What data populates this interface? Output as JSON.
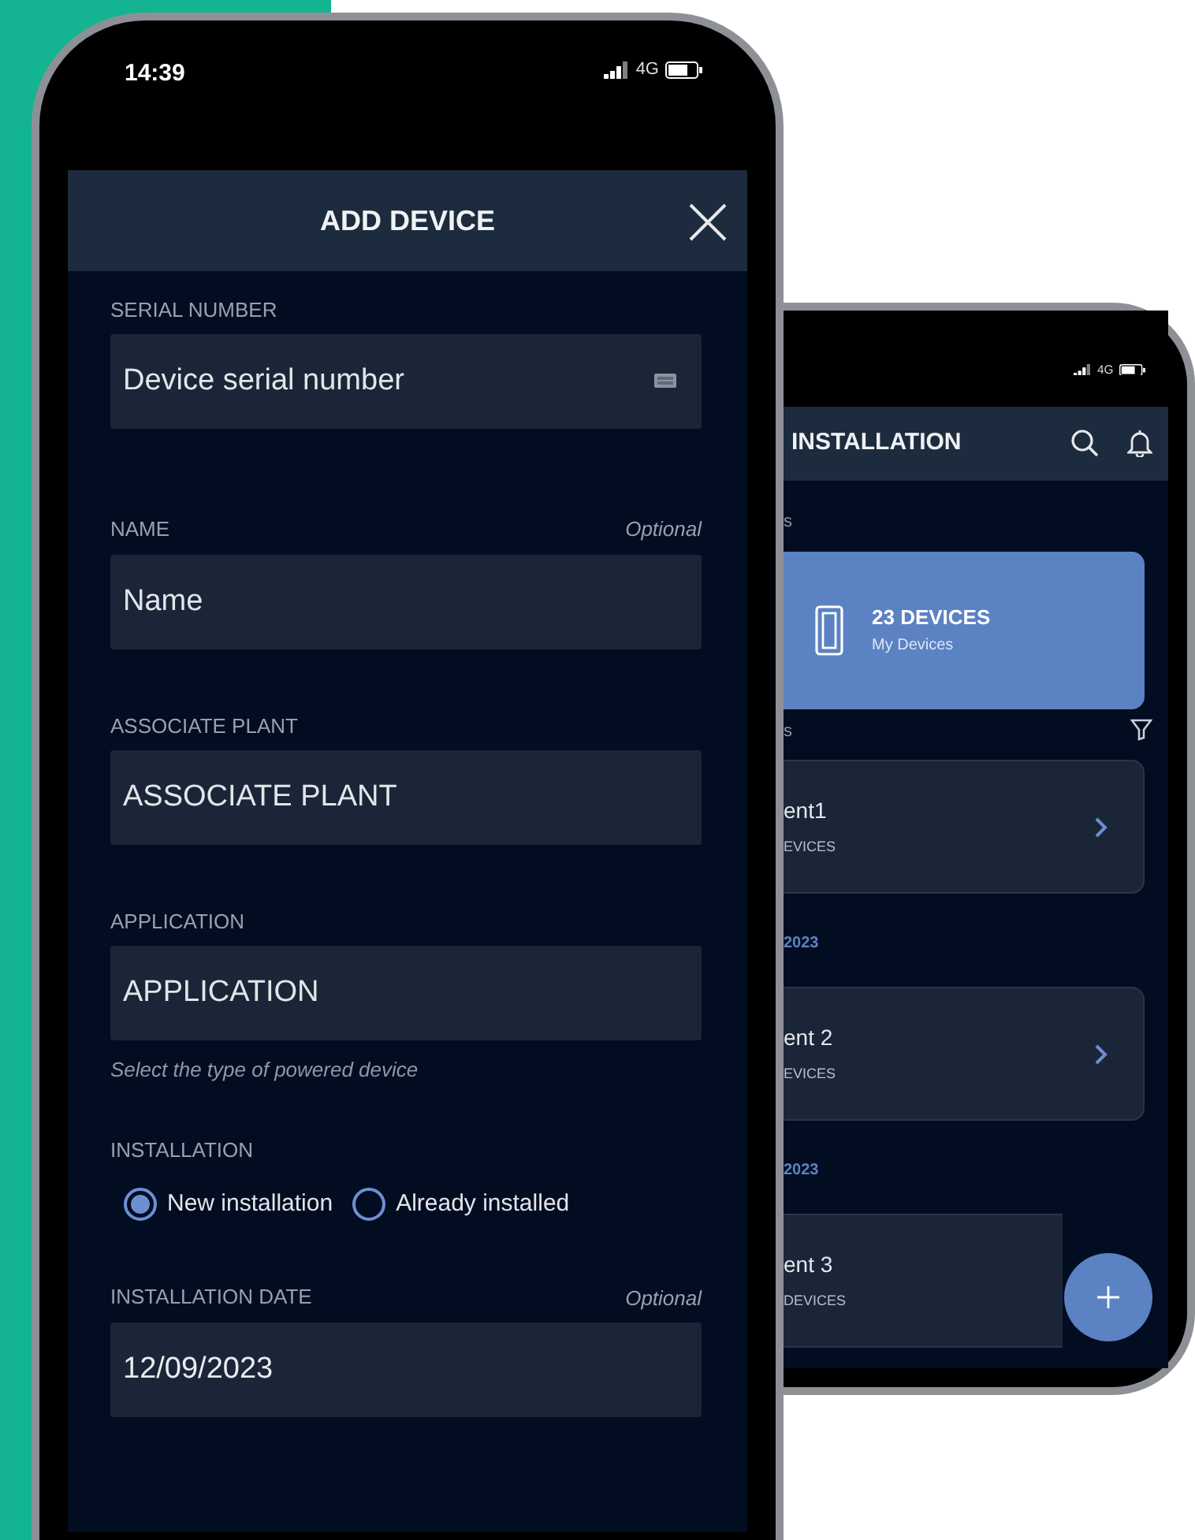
{
  "front_screen": {
    "status_bar": {
      "time": "14:39",
      "network": "4G"
    },
    "header": {
      "title": "ADD DEVICE"
    },
    "fields": [
      {
        "kind": "scan",
        "label": "SERIAL NUMBER",
        "placeholder": "Device serial number"
      },
      {
        "kind": "text",
        "label": "NAME",
        "optional": "Optional",
        "placeholder": "Name"
      },
      {
        "kind": "text",
        "label": "ASSOCIATE PLANT",
        "placeholder": "ASSOCIATE PLANT"
      },
      {
        "kind": "text",
        "label": "APPLICATION",
        "placeholder": "APPLICATION",
        "hint": "Select the type of powered device"
      },
      {
        "kind": "radio",
        "label": "INSTALLATION",
        "options": [
          {
            "label": "New installation",
            "selected": true
          },
          {
            "label": "Already installed",
            "selected": false
          }
        ]
      },
      {
        "kind": "text",
        "label": "INSTALLATION DATE",
        "optional": "Optional",
        "value": "12/09/2023"
      }
    ]
  },
  "back_screen": {
    "status_bar": {
      "network": "4G"
    },
    "header": {
      "title": "INSTALLATION"
    },
    "section_1": "s",
    "summary": {
      "count": "23 DEVICES",
      "caption": "My Devices"
    },
    "section_2": "s",
    "list": [
      {
        "kind": "card",
        "name": "ent1",
        "count": "EVICES",
        "chevron": true
      },
      {
        "kind": "date",
        "text": "2023"
      },
      {
        "kind": "card",
        "name": "ent 2",
        "count": "EVICES",
        "chevron": true
      },
      {
        "kind": "date",
        "text": "2023"
      },
      {
        "kind": "card",
        "name": "ent 3",
        "count": "DEVICES",
        "chevron": false
      }
    ]
  }
}
